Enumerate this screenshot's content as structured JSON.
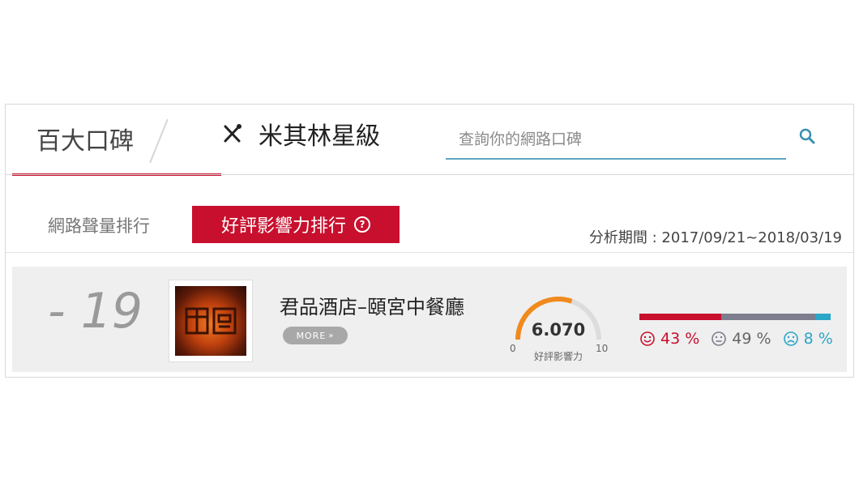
{
  "top_tabs": [
    {
      "label": "百大口碑",
      "active": true
    },
    {
      "label": "米其林星級",
      "active": false,
      "icon": "fork-knife-icon"
    }
  ],
  "search": {
    "placeholder": "查詢你的網路口碑",
    "icon": "search-icon"
  },
  "sub_tabs": [
    {
      "label": "網路聲量排行",
      "active": false
    },
    {
      "label": "好評影響力排行",
      "active": true,
      "icon": "help-icon"
    }
  ],
  "period": "分析期間 : 2017/09/21~2018/03/19",
  "entry": {
    "rank": "- 19",
    "name": "君品酒店–頤宮中餐廳",
    "more_label": "MORE",
    "gauge": {
      "score": "6.070",
      "min": "0",
      "max": "10",
      "label": "好評影響力",
      "value": 6.07
    },
    "sentiment": [
      {
        "name": "positive",
        "percent": "43 %",
        "value": 43,
        "color": "#c8102e",
        "icon": "happy-face-icon"
      },
      {
        "name": "neutral",
        "percent": "49 %",
        "value": 49,
        "color": "#7d7d8f",
        "icon": "neutral-face-icon"
      },
      {
        "name": "negative",
        "percent": "8 %",
        "value": 8,
        "color": "#2aa6c8",
        "icon": "sad-face-icon"
      }
    ]
  },
  "colors": {
    "accent": "#c8102e",
    "search_line": "#5fa6c2",
    "gauge": "#f08a1c"
  }
}
